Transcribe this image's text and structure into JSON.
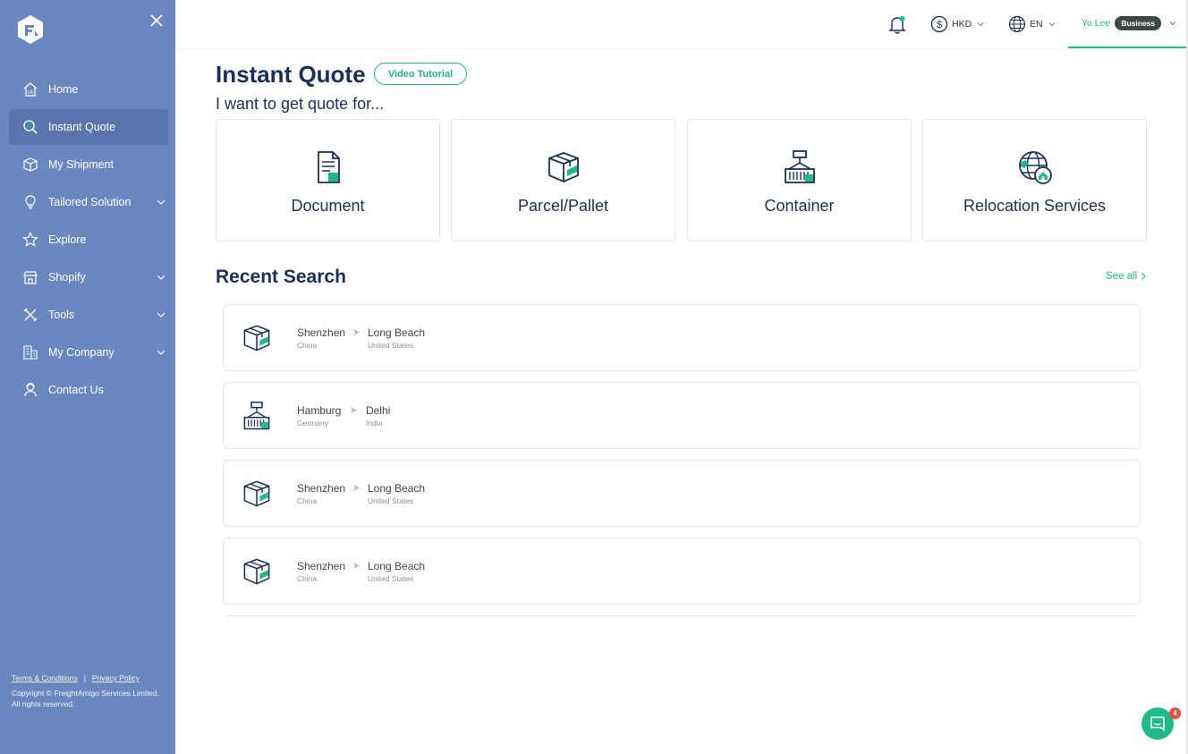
{
  "sidebar": {
    "items": [
      {
        "label": "Home",
        "icon": "home-icon"
      },
      {
        "label": "Instant Quote",
        "icon": "quote-search-icon"
      },
      {
        "label": "My Shipment",
        "icon": "box-icon"
      },
      {
        "label": "Tailored Solution",
        "icon": "lightbulb-icon"
      },
      {
        "label": "Explore",
        "icon": "star-icon"
      },
      {
        "label": "Shopify",
        "icon": "store-icon"
      },
      {
        "label": "Tools",
        "icon": "tools-icon"
      },
      {
        "label": "My Company",
        "icon": "building-icon"
      },
      {
        "label": "Contact Us",
        "icon": "support-agent-icon"
      }
    ],
    "terms": "Terms & Conditions",
    "separator": "|",
    "privacy": "Privacy Policy",
    "copyright": "Copyright © FreightAmigo Services Limited. All rights reserved."
  },
  "header": {
    "currency": "HKD",
    "language": "EN",
    "user_name": "Yo Lee",
    "user_badge": "Business"
  },
  "main": {
    "title": "Instant Quote",
    "video_tutorial": "Video Tutorial",
    "subtitle": "I want to get quote for...",
    "cards": [
      {
        "label": "Document",
        "icon": "document-icon"
      },
      {
        "label": "Parcel/Pallet",
        "icon": "parcel-icon"
      },
      {
        "label": "Container",
        "icon": "container-icon"
      },
      {
        "label": "Relocation Services",
        "icon": "relocation-globe-icon"
      }
    ],
    "recent_title": "Recent Search",
    "see_all": "See all",
    "recent": [
      {
        "type": "parcel-icon",
        "from_city": "Shenzhen",
        "from_country": "China",
        "to_city": "Long Beach",
        "to_country": "United States"
      },
      {
        "type": "container-icon",
        "from_city": "Hamburg",
        "from_country": "Germany",
        "to_city": "Delhi",
        "to_country": "India"
      },
      {
        "type": "parcel-icon",
        "from_city": "Shenzhen",
        "from_country": "China",
        "to_city": "Long Beach",
        "to_country": "United States"
      },
      {
        "type": "parcel-icon",
        "from_city": "Shenzhen",
        "from_country": "China",
        "to_city": "Long Beach",
        "to_country": "United States"
      }
    ]
  },
  "chat": {
    "badge": "4"
  },
  "colors": {
    "sidebar": "#6b87bf",
    "accent": "#1fb98b",
    "navy": "#1b2f58"
  }
}
